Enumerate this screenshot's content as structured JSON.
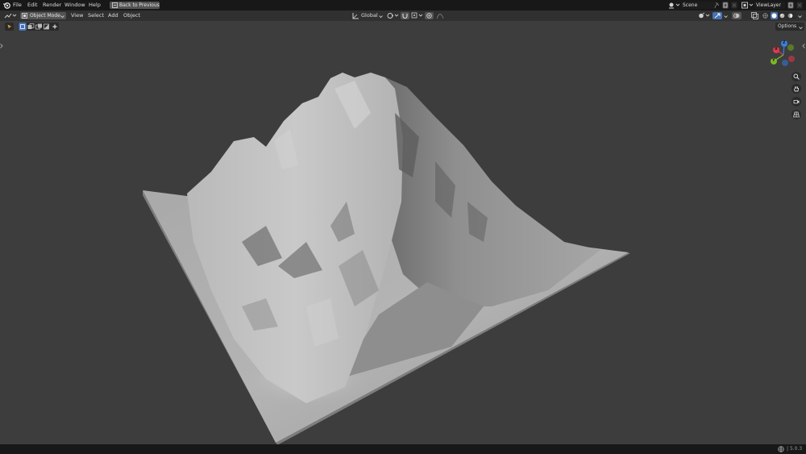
{
  "topbar": {
    "menus": [
      "File",
      "Edit",
      "Render",
      "Window",
      "Help"
    ],
    "back_button": "Back to Previous",
    "scene_name": "Scene",
    "view_layer": "ViewLayer"
  },
  "header": {
    "mode": "Object Mode",
    "menus": [
      "View",
      "Select",
      "Add",
      "Object"
    ],
    "transform_orientation": "Global"
  },
  "tool_header": {
    "options_label": "Options"
  },
  "gizmo": {
    "axes": [
      "X",
      "Y",
      "Z"
    ],
    "colors": {
      "x": "#e0394f",
      "y": "#7eb724",
      "z": "#3c80e2"
    }
  },
  "status": {
    "version": "5.0.3"
  },
  "viewport": {
    "background": "#3d3d3d",
    "object": "terrain-mesh"
  }
}
